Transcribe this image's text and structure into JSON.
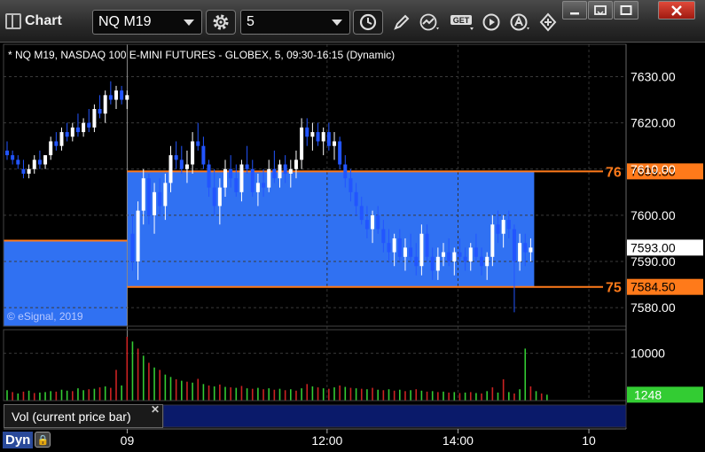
{
  "window": {
    "title": "Chart"
  },
  "toolbar": {
    "symbol": "NQ M19",
    "interval": "5"
  },
  "chart": {
    "subtitle": "* NQ M19, NASDAQ 100 E-MINI FUTURES - GLOBEX, 5, 09:30-16:15 (Dynamic)",
    "copyright": "© eSignal, 2019",
    "study_label": "Vol (current price bar)",
    "mode_label": "Dyn"
  },
  "colors": {
    "up_candle": "#ffffff",
    "down_candle": "#2255ff",
    "zone_fill": "#3377ff",
    "level_line": "#ff7a1a",
    "vol_up": "#33cc33",
    "vol_down": "#cc2222",
    "last_volume_tag": "#33cc33"
  },
  "chart_data": {
    "type": "candlestick",
    "price_axis": {
      "range": [
        7576,
        7637
      ],
      "ticks": [
        7630,
        7620,
        7610,
        7600,
        7590,
        7580
      ],
      "tick_labels": [
        "7630.00",
        "7620.00",
        "7610.00",
        "7600.00",
        "7590.00",
        "7580.00"
      ]
    },
    "time_axis": {
      "ticks": [
        {
          "label": "09",
          "bar": 23
        },
        {
          "label": "12:00",
          "bar": 59
        },
        {
          "label": "14:00",
          "bar": 83
        },
        {
          "label": "10",
          "bar": 107
        }
      ]
    },
    "levels": [
      {
        "label": "76",
        "price": 7609.5,
        "tag": "7609.50"
      },
      {
        "label": "75",
        "price": 7584.5,
        "tag": "7584.50"
      }
    ],
    "prior_level": 7594.5,
    "last_price": {
      "price": 7593.0,
      "tag": "7593.00"
    },
    "volume_axis": {
      "range": [
        0,
        15000
      ],
      "ticks": [
        10000
      ],
      "tick_labels": [
        "10000"
      ]
    },
    "last_volume": {
      "value": 1248,
      "tag": "1248"
    },
    "bars": [
      [
        7614,
        7616,
        7612,
        7613
      ],
      [
        7613,
        7614,
        7611,
        7612
      ],
      [
        7612,
        7613,
        7610,
        7611
      ],
      [
        7610,
        7612,
        7608,
        7609
      ],
      [
        7609,
        7611,
        7608,
        7610
      ],
      [
        7610,
        7613,
        7609,
        7612
      ],
      [
        7612,
        7614,
        7610,
        7611
      ],
      [
        7611,
        7613,
        7610,
        7613
      ],
      [
        7613,
        7617,
        7612,
        7616
      ],
      [
        7616,
        7618,
        7614,
        7615
      ],
      [
        7615,
        7619,
        7614,
        7618
      ],
      [
        7618,
        7620,
        7616,
        7617
      ],
      [
        7617,
        7620,
        7616,
        7619
      ],
      [
        7619,
        7622,
        7617,
        7618
      ],
      [
        7618,
        7621,
        7617,
        7620
      ],
      [
        7620,
        7623,
        7618,
        7619
      ],
      [
        7619,
        7624,
        7618,
        7623
      ],
      [
        7623,
        7626,
        7621,
        7622
      ],
      [
        7622,
        7627,
        7620,
        7626
      ],
      [
        7626,
        7629,
        7624,
        7625
      ],
      [
        7625,
        7628,
        7623,
        7627
      ],
      [
        7627,
        7628,
        7624,
        7625
      ],
      [
        7625,
        7627,
        7623,
        7626
      ],
      [
        7596,
        7600,
        7588,
        7590
      ],
      [
        7590,
        7603,
        7586,
        7601
      ],
      [
        7601,
        7610,
        7598,
        7608
      ],
      [
        7608,
        7609,
        7598,
        7600
      ],
      [
        7600,
        7607,
        7596,
        7605
      ],
      [
        7605,
        7608,
        7600,
        7602
      ],
      [
        7602,
        7609,
        7599,
        7607
      ],
      [
        7607,
        7615,
        7605,
        7613
      ],
      [
        7613,
        7616,
        7610,
        7612
      ],
      [
        7612,
        7615,
        7609,
        7610
      ],
      [
        7610,
        7614,
        7607,
        7611
      ],
      [
        7611,
        7618,
        7609,
        7616
      ],
      [
        7616,
        7620,
        7614,
        7615
      ],
      [
        7615,
        7617,
        7610,
        7611
      ],
      [
        7611,
        7612,
        7604,
        7606
      ],
      [
        7606,
        7610,
        7600,
        7602
      ],
      [
        7602,
        7608,
        7598,
        7606
      ],
      [
        7606,
        7612,
        7604,
        7610
      ],
      [
        7610,
        7613,
        7606,
        7608
      ],
      [
        7608,
        7611,
        7604,
        7605
      ],
      [
        7605,
        7612,
        7603,
        7611
      ],
      [
        7611,
        7615,
        7609,
        7610
      ],
      [
        7610,
        7612,
        7604,
        7605
      ],
      [
        7605,
        7609,
        7602,
        7607
      ],
      [
        7607,
        7610,
        7604,
        7606
      ],
      [
        7606,
        7612,
        7605,
        7610
      ],
      [
        7610,
        7614,
        7607,
        7608
      ],
      [
        7608,
        7612,
        7606,
        7611
      ],
      [
        7611,
        7613,
        7607,
        7609
      ],
      [
        7609,
        7612,
        7606,
        7610
      ],
      [
        7610,
        7614,
        7608,
        7612
      ],
      [
        7612,
        7621,
        7610,
        7619
      ],
      [
        7619,
        7621,
        7615,
        7617
      ],
      [
        7617,
        7620,
        7614,
        7618
      ],
      [
        7618,
        7620,
        7615,
        7616
      ],
      [
        7616,
        7619,
        7613,
        7618
      ],
      [
        7618,
        7620,
        7614,
        7615
      ],
      [
        7615,
        7618,
        7612,
        7616
      ],
      [
        7616,
        7617,
        7610,
        7611
      ],
      [
        7611,
        7613,
        7606,
        7608
      ],
      [
        7608,
        7610,
        7603,
        7605
      ],
      [
        7605,
        7607,
        7600,
        7602
      ],
      [
        7602,
        7604,
        7598,
        7599
      ],
      [
        7599,
        7602,
        7595,
        7597
      ],
      [
        7597,
        7601,
        7594,
        7600
      ],
      [
        7600,
        7602,
        7596,
        7597
      ],
      [
        7597,
        7599,
        7592,
        7594
      ],
      [
        7594,
        7597,
        7590,
        7592
      ],
      [
        7592,
        7596,
        7589,
        7595
      ],
      [
        7595,
        7597,
        7590,
        7591
      ],
      [
        7591,
        7595,
        7588,
        7593
      ],
      [
        7593,
        7596,
        7590,
        7591
      ],
      [
        7591,
        7594,
        7587,
        7589
      ],
      [
        7589,
        7598,
        7587,
        7596
      ],
      [
        7596,
        7598,
        7590,
        7591
      ],
      [
        7591,
        7593,
        7586,
        7588
      ],
      [
        7588,
        7593,
        7586,
        7591
      ],
      [
        7591,
        7594,
        7589,
        7592
      ],
      [
        7592,
        7595,
        7589,
        7590
      ],
      [
        7590,
        7593,
        7587,
        7592
      ],
      [
        7592,
        7595,
        7590,
        7591
      ],
      [
        7591,
        7593,
        7588,
        7590
      ],
      [
        7590,
        7594,
        7588,
        7593
      ],
      [
        7593,
        7596,
        7590,
        7591
      ],
      [
        7591,
        7593,
        7587,
        7589
      ],
      [
        7589,
        7592,
        7586,
        7591
      ],
      [
        7591,
        7600,
        7589,
        7598
      ],
      [
        7598,
        7601,
        7594,
        7596
      ],
      [
        7596,
        7600,
        7593,
        7599
      ],
      [
        7599,
        7601,
        7595,
        7597
      ],
      [
        7597,
        7598,
        7579,
        7590
      ],
      [
        7590,
        7596,
        7588,
        7594
      ],
      [
        7594,
        7596,
        7589,
        7592
      ],
      [
        7592,
        7595,
        7590,
        7593
      ]
    ],
    "volume": [
      [
        2200,
        1
      ],
      [
        1800,
        0
      ],
      [
        1500,
        1
      ],
      [
        1900,
        0
      ],
      [
        2100,
        1
      ],
      [
        1600,
        0
      ],
      [
        1700,
        1
      ],
      [
        1800,
        1
      ],
      [
        2000,
        1
      ],
      [
        1900,
        0
      ],
      [
        2300,
        1
      ],
      [
        2100,
        1
      ],
      [
        2000,
        0
      ],
      [
        2600,
        1
      ],
      [
        2200,
        1
      ],
      [
        2400,
        0
      ],
      [
        2500,
        1
      ],
      [
        2800,
        0
      ],
      [
        3000,
        1
      ],
      [
        2700,
        0
      ],
      [
        6500,
        0
      ],
      [
        3200,
        1
      ],
      [
        13500,
        0
      ],
      [
        12500,
        1
      ],
      [
        11000,
        0
      ],
      [
        9500,
        1
      ],
      [
        8000,
        0
      ],
      [
        7000,
        1
      ],
      [
        6500,
        0
      ],
      [
        5500,
        1
      ],
      [
        5000,
        1
      ],
      [
        4500,
        0
      ],
      [
        4200,
        1
      ],
      [
        4000,
        0
      ],
      [
        3800,
        1
      ],
      [
        4600,
        0
      ],
      [
        3500,
        1
      ],
      [
        3200,
        0
      ],
      [
        3000,
        1
      ],
      [
        3400,
        0
      ],
      [
        2900,
        1
      ],
      [
        2800,
        0
      ],
      [
        2700,
        1
      ],
      [
        3100,
        0
      ],
      [
        2600,
        1
      ],
      [
        2500,
        0
      ],
      [
        2700,
        1
      ],
      [
        2400,
        0
      ],
      [
        2600,
        1
      ],
      [
        2300,
        0
      ],
      [
        2500,
        1
      ],
      [
        2200,
        0
      ],
      [
        2400,
        1
      ],
      [
        2100,
        0
      ],
      [
        2600,
        1
      ],
      [
        3500,
        0
      ],
      [
        3000,
        1
      ],
      [
        2800,
        0
      ],
      [
        2600,
        1
      ],
      [
        2500,
        0
      ],
      [
        2800,
        1
      ],
      [
        3200,
        0
      ],
      [
        2900,
        1
      ],
      [
        2700,
        0
      ],
      [
        2600,
        1
      ],
      [
        2500,
        0
      ],
      [
        2400,
        1
      ],
      [
        2700,
        0
      ],
      [
        2300,
        1
      ],
      [
        2200,
        0
      ],
      [
        2400,
        1
      ],
      [
        2100,
        0
      ],
      [
        2300,
        1
      ],
      [
        2000,
        0
      ],
      [
        2200,
        1
      ],
      [
        2400,
        0
      ],
      [
        2100,
        1
      ],
      [
        1900,
        0
      ],
      [
        2000,
        1
      ],
      [
        1800,
        0
      ],
      [
        1900,
        1
      ],
      [
        1700,
        0
      ],
      [
        1800,
        1
      ],
      [
        1600,
        0
      ],
      [
        1700,
        1
      ],
      [
        1800,
        0
      ],
      [
        1600,
        1
      ],
      [
        1500,
        0
      ],
      [
        2000,
        1
      ],
      [
        2800,
        0
      ],
      [
        1700,
        1
      ],
      [
        4500,
        0
      ],
      [
        1800,
        1
      ],
      [
        1500,
        0
      ],
      [
        2400,
        1
      ],
      [
        11000,
        1
      ],
      [
        3000,
        0
      ],
      [
        2000,
        1
      ],
      [
        1500,
        0
      ],
      [
        1248,
        1
      ]
    ]
  }
}
